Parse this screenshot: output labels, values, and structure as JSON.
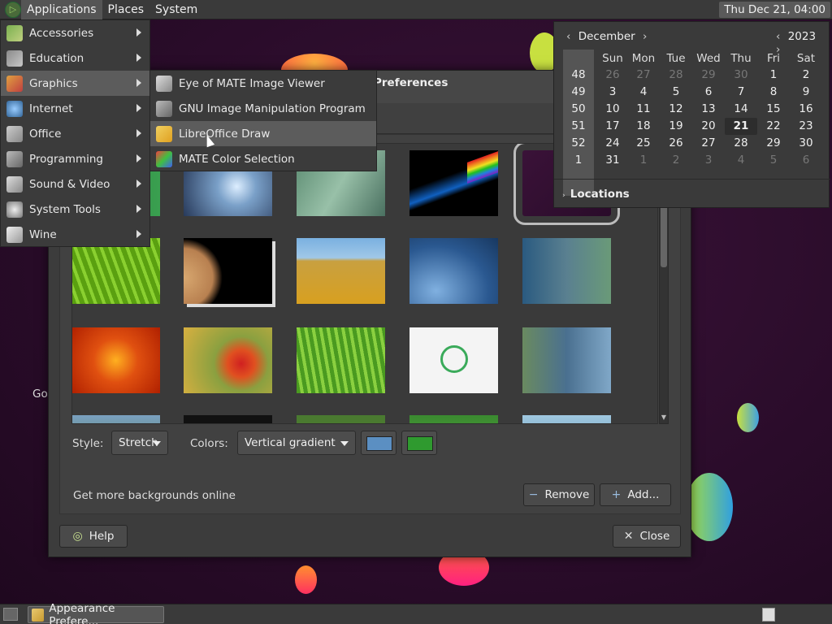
{
  "panel": {
    "menus": [
      "Applications",
      "Places",
      "System"
    ],
    "clock": "Thu Dec 21, 04:00"
  },
  "taskbar": {
    "task_label": "Appearance Prefere..."
  },
  "dialog": {
    "title": "Preferences",
    "style_label": "Style:",
    "style_value": "Stretch",
    "colors_label": "Colors:",
    "colors_value": "Vertical gradient",
    "primary_color": "#5b8fc2",
    "secondary_color": "#2f9a2f",
    "get_more": "Get more backgrounds online",
    "remove_label": "Remove",
    "add_label": "Add...",
    "help_label": "Help",
    "close_label": "Close"
  },
  "app_menu": {
    "items": [
      {
        "label": "Accessories",
        "icon": "accessories-icon"
      },
      {
        "label": "Education",
        "icon": "education-icon"
      },
      {
        "label": "Graphics",
        "icon": "graphics-icon"
      },
      {
        "label": "Internet",
        "icon": "internet-icon"
      },
      {
        "label": "Office",
        "icon": "office-icon"
      },
      {
        "label": "Programming",
        "icon": "programming-icon"
      },
      {
        "label": "Sound & Video",
        "icon": "sound-video-icon"
      },
      {
        "label": "System Tools",
        "icon": "system-tools-icon"
      },
      {
        "label": "Wine",
        "icon": "wine-icon"
      }
    ],
    "active_index": 2
  },
  "graphics_submenu": {
    "items": [
      {
        "label": "Eye of MATE Image Viewer",
        "icon": "image-viewer-icon"
      },
      {
        "label": "GNU Image Manipulation Program",
        "icon": "gimp-icon"
      },
      {
        "label": "LibreOffice Draw",
        "icon": "libreoffice-draw-icon"
      },
      {
        "label": "MATE Color Selection",
        "icon": "color-selection-icon"
      }
    ],
    "active_index": 2
  },
  "calendar": {
    "month": "December",
    "year": "2023",
    "weekdays": [
      "Sun",
      "Mon",
      "Tue",
      "Wed",
      "Thu",
      "Fri",
      "Sat"
    ],
    "weeks": [
      {
        "num": "48",
        "days": [
          "26",
          "27",
          "28",
          "29",
          "30",
          "1",
          "2"
        ]
      },
      {
        "num": "49",
        "days": [
          "3",
          "4",
          "5",
          "6",
          "7",
          "8",
          "9"
        ]
      },
      {
        "num": "50",
        "days": [
          "10",
          "11",
          "12",
          "13",
          "14",
          "15",
          "16"
        ]
      },
      {
        "num": "51",
        "days": [
          "17",
          "18",
          "19",
          "20",
          "21",
          "22",
          "23"
        ]
      },
      {
        "num": "52",
        "days": [
          "24",
          "25",
          "26",
          "27",
          "28",
          "29",
          "30"
        ]
      },
      {
        "num": "1",
        "days": [
          "31",
          "1",
          "2",
          "3",
          "4",
          "5",
          "6"
        ]
      }
    ],
    "today": "21",
    "locations_label": "Locations"
  },
  "desktop": {
    "partial_text": "Go"
  }
}
